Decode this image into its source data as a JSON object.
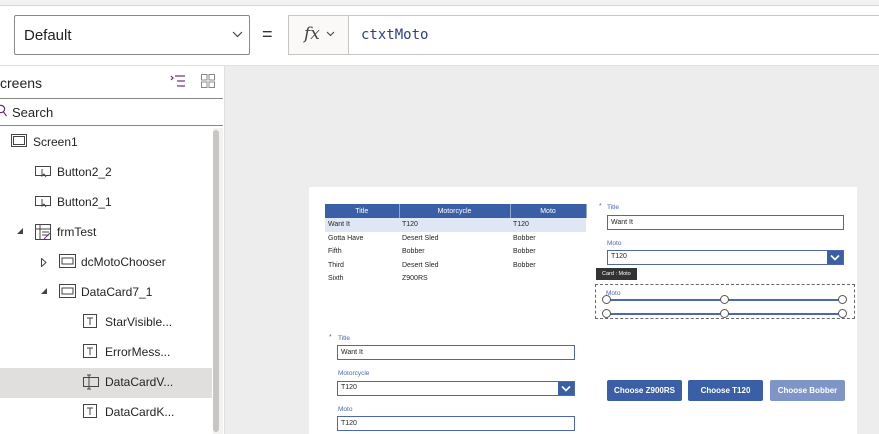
{
  "formula_bar": {
    "property": "Default",
    "equals": "=",
    "fx_label": "fx",
    "formula": "ctxtMoto"
  },
  "panel": {
    "title": "creens",
    "search_placeholder": "Search",
    "tree": [
      {
        "label": "Screen1",
        "icon": "screen-icon"
      },
      {
        "label": "Button2_2",
        "icon": "button-icon"
      },
      {
        "label": "Button2_1",
        "icon": "button-icon"
      },
      {
        "label": "frmTest",
        "icon": "form-icon"
      },
      {
        "label": "dcMotoChooser",
        "icon": "datacard-icon"
      },
      {
        "label": "DataCard7_1",
        "icon": "datacard-icon"
      },
      {
        "label": "StarVisible...",
        "icon": "label-icon"
      },
      {
        "label": "ErrorMess...",
        "icon": "label-icon"
      },
      {
        "label": "DataCardV...",
        "icon": "textinput-icon"
      },
      {
        "label": "DataCardK...",
        "icon": "label-icon"
      }
    ]
  },
  "app": {
    "table": {
      "headers": [
        "Title",
        "Motorcycle",
        "Moto"
      ],
      "rows": [
        [
          "Want It",
          "T120",
          "T120"
        ],
        [
          "Gotta Have",
          "Desert Sled",
          "Bobber"
        ],
        [
          "Fifth",
          "Bobber",
          "Bobber"
        ],
        [
          "Third",
          "Desert Sled",
          "Bobber"
        ],
        [
          "Sixth",
          "Z900RS",
          ""
        ]
      ]
    },
    "form_right": {
      "required_mark": "*",
      "title_label": "Title",
      "title_value": "Want It",
      "moto_label": "Moto",
      "moto_value": "T120",
      "tooltip": "Card : Moto",
      "selected_label": "Moto"
    },
    "form_left": {
      "required_mark": "*",
      "title_label": "Title",
      "title_value": "Want It",
      "motorcycle_label": "Motorcycle",
      "motorcycle_value": "T120",
      "moto_label": "Moto",
      "moto_value": "T120"
    },
    "buttons": [
      "Choose Z900RS",
      "Choose T120",
      "Choose Bobber"
    ],
    "colors": {
      "primary": "#3b5fa6",
      "disabled_button": "#7f95c8",
      "label_blue": "#4e67b0"
    }
  }
}
